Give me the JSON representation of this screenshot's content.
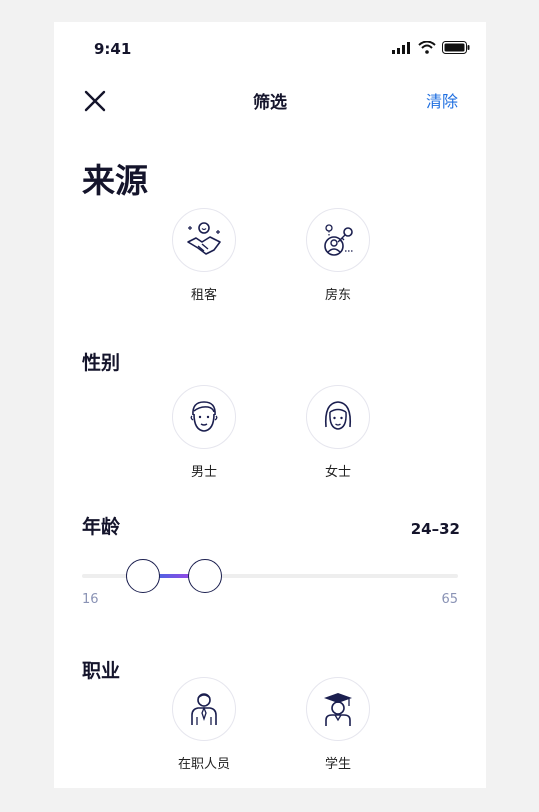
{
  "status_bar": {
    "time": "9:41"
  },
  "header": {
    "title": "筛选",
    "clear_label": "清除"
  },
  "source": {
    "title": "来源",
    "options": [
      {
        "label": "租客",
        "icon": "handshake-icon"
      },
      {
        "label": "房东",
        "icon": "landlord-key-icon"
      }
    ]
  },
  "gender": {
    "title": "性别",
    "options": [
      {
        "label": "男士",
        "icon": "male-face-icon"
      },
      {
        "label": "女士",
        "icon": "female-face-icon"
      }
    ]
  },
  "age": {
    "title": "年龄",
    "range_text": "24–32",
    "min": 16,
    "max": 65,
    "low": 24,
    "high": 32,
    "min_label": "16",
    "max_label": "65",
    "gradient_colors": [
      "#2f6fe0",
      "#b33de8"
    ]
  },
  "occupation": {
    "title": "职业",
    "options": [
      {
        "label": "在职人员",
        "icon": "employee-icon"
      },
      {
        "label": "学生",
        "icon": "graduate-icon"
      }
    ]
  },
  "colors": {
    "accent": "#1f6fe0",
    "text": "#14142b",
    "muted": "#8a93b5"
  }
}
